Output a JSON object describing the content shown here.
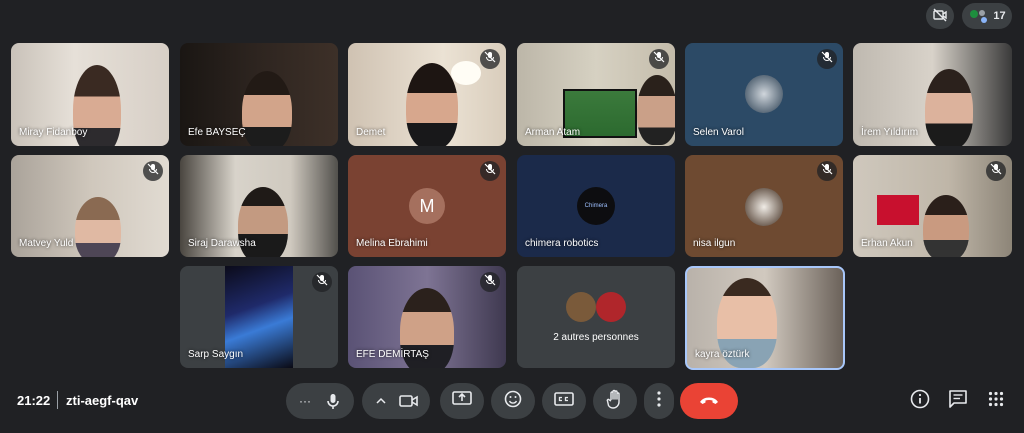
{
  "top": {
    "participant_count": "17"
  },
  "tiles": [
    {
      "name": "Miray Fidanboy"
    },
    {
      "name": "Efe BAYSEÇ"
    },
    {
      "name": "Demet"
    },
    {
      "name": "Arman Atam"
    },
    {
      "name": "Selen Varol"
    },
    {
      "name": "İrem Yıldırım"
    },
    {
      "name": "Matvey Yuld"
    },
    {
      "name": "Siraj Darawsha"
    },
    {
      "name": "Melina Ebrahimi",
      "avatar_letter": "M"
    },
    {
      "name": "chimera robotics",
      "avatar_text": "Chimera"
    },
    {
      "name": "nisa ilgun"
    },
    {
      "name": "Erhan Akun"
    },
    {
      "name": "Sarp Saygın"
    },
    {
      "name": "EFE DEMİRTAŞ"
    },
    {
      "name": "2 autres personnes"
    },
    {
      "name": "kayra öztürk"
    }
  ],
  "meeting": {
    "time": "21:22",
    "code": "zti-aegf-qav"
  },
  "icons": {
    "camera_off": "camera-off-icon",
    "people": "people-icon",
    "mic": "mic-icon",
    "camera": "camera-icon",
    "present": "present-icon",
    "emoji": "emoji-icon",
    "captions": "captions-icon",
    "hand": "raise-hand-icon",
    "more": "more-icon",
    "hangup": "hangup-icon",
    "info": "info-icon",
    "chat": "chat-icon",
    "activities": "apps-icon"
  },
  "colors": {
    "background": "#202124",
    "button": "#3c4043",
    "hangup": "#ea4335",
    "active_border": "#a8c7fa"
  }
}
